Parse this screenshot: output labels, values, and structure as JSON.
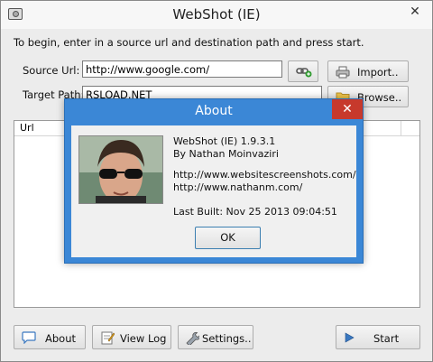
{
  "window": {
    "title": "WebShot (IE)",
    "close_glyph": "✕"
  },
  "intro_text": "To begin, enter in a source url and destination path and press start.",
  "source": {
    "label": "Source Url:",
    "value": "http://www.google.com/",
    "import_label": "Import.."
  },
  "target": {
    "label": "Target Path:",
    "value": "RSLOAD.NET",
    "browse_label": "Browse.."
  },
  "list": {
    "columns": [
      "Url"
    ]
  },
  "toolbar": {
    "about_label": "About",
    "viewlog_label": "View Log",
    "settings_label": "Settings..",
    "start_label": "Start"
  },
  "about_dialog": {
    "title": "About",
    "close_glyph": "✕",
    "app_line": "WebShot (IE) 1.9.3.1",
    "author_line": "By Nathan Moinvaziri",
    "url1": "http://www.websitescreenshots.com/",
    "url2": "http://www.nathanm.com/",
    "built_line": "Last Built: Nov 25 2013 09:04:51",
    "ok_label": "OK"
  },
  "colors": {
    "dialog_title_bg": "#3b87d6",
    "dialog_close_bg": "#c7392c"
  }
}
